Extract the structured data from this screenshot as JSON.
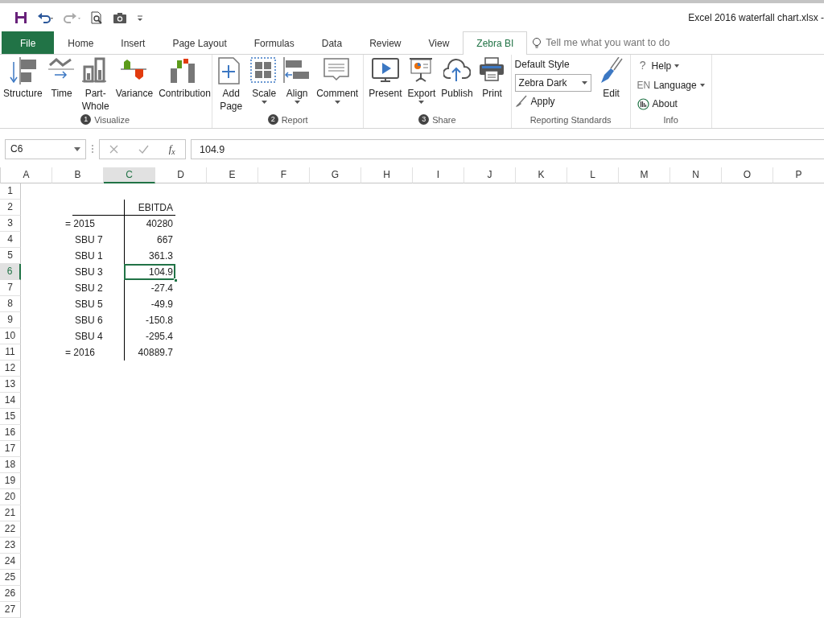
{
  "window": {
    "title": "Excel 2016 waterfall chart.xlsx -"
  },
  "tabs": [
    {
      "label": "File",
      "kind": "file",
      "selected": false
    },
    {
      "label": "Home",
      "kind": "tab",
      "selected": false
    },
    {
      "label": "Insert",
      "kind": "tab",
      "selected": false
    },
    {
      "label": "Page Layout",
      "kind": "tab",
      "selected": false
    },
    {
      "label": "Formulas",
      "kind": "tab",
      "selected": false
    },
    {
      "label": "Data",
      "kind": "tab",
      "selected": false
    },
    {
      "label": "Review",
      "kind": "tab",
      "selected": false
    },
    {
      "label": "View",
      "kind": "tab",
      "selected": false
    },
    {
      "label": "Zebra BI",
      "kind": "tab",
      "selected": true
    }
  ],
  "tell_me": {
    "placeholder": "Tell me what you want to do"
  },
  "ribbon_groups": [
    {
      "label": "Visualize",
      "step": "1",
      "items": [
        {
          "label": "Structure"
        },
        {
          "label": "Time"
        },
        {
          "label": "Part-Whole"
        },
        {
          "label": "Variance"
        },
        {
          "label": "Contribution"
        }
      ]
    },
    {
      "label": "Report",
      "step": "2",
      "items": [
        {
          "label": "Add Page"
        },
        {
          "label": "Scale",
          "dropdown": true
        },
        {
          "label": "Align",
          "dropdown": true
        },
        {
          "label": "Comment",
          "dropdown": true
        }
      ]
    },
    {
      "label": "Share",
      "step": "3",
      "items": [
        {
          "label": "Present"
        },
        {
          "label": "Export",
          "dropdown": true
        },
        {
          "label": "Publish"
        },
        {
          "label": "Print"
        }
      ]
    }
  ],
  "reporting_standards": {
    "label": "Reporting Standards",
    "style_label": "Default Style",
    "style_value": "Zebra Dark",
    "apply": "Apply",
    "edit": "Edit"
  },
  "info": {
    "label": "Info",
    "help_glyph": "?",
    "help": "Help",
    "language_prefix": "EN",
    "language": "Language",
    "about": "About"
  },
  "formula_bar": {
    "name_box": "C6",
    "function": "f$_{x}$",
    "value": "104.9"
  },
  "columns": [
    {
      "label": "A",
      "selected": false
    },
    {
      "label": "B",
      "selected": false
    },
    {
      "label": "C",
      "selected": true
    },
    {
      "label": "D",
      "selected": false
    },
    {
      "label": "E",
      "selected": false
    },
    {
      "label": "F",
      "selected": false
    },
    {
      "label": "G",
      "selected": false
    },
    {
      "label": "H",
      "selected": false
    },
    {
      "label": "I",
      "selected": false
    },
    {
      "label": "J",
      "selected": false
    },
    {
      "label": "K",
      "selected": false
    },
    {
      "label": "L",
      "selected": false
    },
    {
      "label": "M",
      "selected": false
    },
    {
      "label": "N",
      "selected": false
    },
    {
      "label": "O",
      "selected": false
    },
    {
      "label": "P",
      "selected": false
    }
  ],
  "rows": [
    {
      "number": "1",
      "selected": false
    },
    {
      "number": "2",
      "c": "EBITDA",
      "kind": "header",
      "selected": false
    },
    {
      "number": "3",
      "b": "= 2015",
      "c": "40280",
      "kind": "total",
      "selected": false
    },
    {
      "number": "4",
      "b": "SBU 7",
      "c": "667",
      "kind": "item",
      "selected": false
    },
    {
      "number": "5",
      "b": "SBU 1",
      "c": "361.3",
      "kind": "item",
      "selected": false
    },
    {
      "number": "6",
      "b": "SBU 3",
      "c": "104.9",
      "kind": "item",
      "selected": true
    },
    {
      "number": "7",
      "b": "SBU 2",
      "c": "-27.4",
      "kind": "item",
      "selected": false
    },
    {
      "number": "8",
      "b": "SBU 5",
      "c": "-49.9",
      "kind": "item",
      "selected": false
    },
    {
      "number": "9",
      "b": "SBU 6",
      "c": "-150.8",
      "kind": "item",
      "selected": false
    },
    {
      "number": "10",
      "b": "SBU 4",
      "c": "-295.4",
      "kind": "item",
      "selected": false
    },
    {
      "number": "11",
      "b": "= 2016",
      "c": "40889.7",
      "kind": "total",
      "selected": false
    },
    {
      "number": "12",
      "selected": false
    },
    {
      "number": "13",
      "selected": false
    },
    {
      "number": "14",
      "selected": false
    },
    {
      "number": "15",
      "selected": false
    },
    {
      "number": "16",
      "selected": false
    },
    {
      "number": "17",
      "selected": false
    },
    {
      "number": "18",
      "selected": false
    },
    {
      "number": "19",
      "selected": false
    },
    {
      "number": "20",
      "selected": false
    },
    {
      "number": "21",
      "selected": false
    },
    {
      "number": "22",
      "selected": false
    },
    {
      "number": "23",
      "selected": false
    },
    {
      "number": "24",
      "selected": false
    },
    {
      "number": "25",
      "selected": false
    },
    {
      "number": "26",
      "selected": false
    },
    {
      "number": "27",
      "selected": false
    }
  ]
}
